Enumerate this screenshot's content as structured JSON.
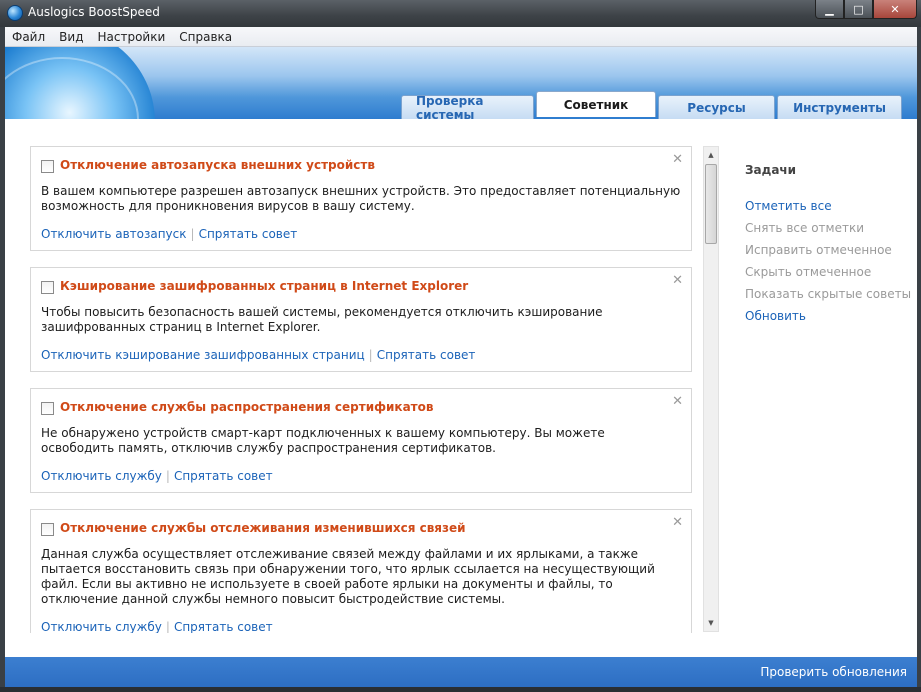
{
  "window": {
    "title": "Auslogics BoostSpeed",
    "controls": {
      "minimize": "▁",
      "maximize": "□",
      "close": "✕"
    }
  },
  "menu": {
    "items": [
      "Файл",
      "Вид",
      "Настройки",
      "Справка"
    ]
  },
  "tabs": {
    "items": [
      "Проверка системы",
      "Советник",
      "Ресурсы",
      "Инструменты"
    ],
    "active": "Советник"
  },
  "advice": [
    {
      "title": "Отключение автозапуска внешних устройств",
      "description": "В вашем компьютере разрешен автозапуск внешних устройств. Это предоставляет потенциальную возможность для проникновения вирусов в вашу систему.",
      "action": "Отключить автозапуск",
      "hide": "Спрятать совет"
    },
    {
      "title": "Кэширование зашифрованных страниц в Internet Explorer",
      "description": "Чтобы повысить безопасность вашей системы, рекомендуется отключить кэширование зашифрованных страниц в Internet Explorer.",
      "action": "Отключить кэширование зашифрованных страниц",
      "hide": "Спрятать совет"
    },
    {
      "title": "Отключение службы распространения сертификатов",
      "description": "Не обнаружено устройств смарт-карт подключенных к вашему компьютеру. Вы можете освободить память, отключив службу распространения сертификатов.",
      "action": "Отключить службу",
      "hide": "Спрятать совет"
    },
    {
      "title": "Отключение службы отслеживания изменившихся связей",
      "description": "Данная служба осуществляет отслеживание связей между файлами и их ярлыками, а также пытается восстановить связь при обнаружении того, что ярлык ссылается на несуществующий файл. Если вы активно не используете в своей работе ярлыки на документы и файлы, то отключение данной службы немного повысит быстродействие системы.",
      "action": "Отключить службу",
      "hide": "Спрятать совет"
    }
  ],
  "tasks": {
    "title": "Задачи",
    "items": [
      {
        "label": "Отметить все",
        "enabled": true
      },
      {
        "label": "Снять все отметки",
        "enabled": false
      },
      {
        "label": "Исправить отмеченное",
        "enabled": false
      },
      {
        "label": "Скрыть отмеченное",
        "enabled": false
      },
      {
        "label": "Показать скрытые советы",
        "enabled": false
      },
      {
        "label": "Обновить",
        "enabled": true
      }
    ]
  },
  "footer": {
    "update_link": "Проверить обновления"
  }
}
